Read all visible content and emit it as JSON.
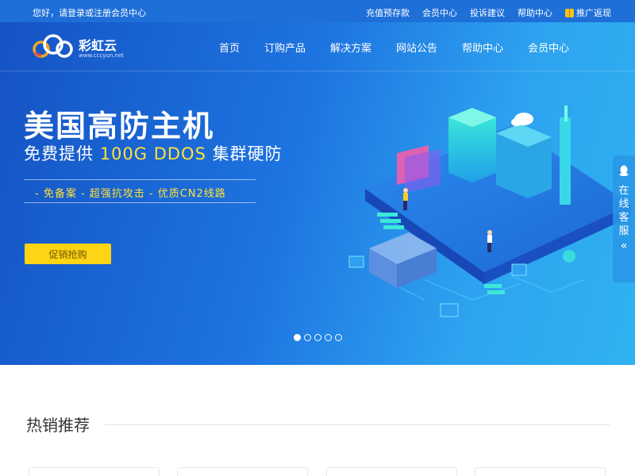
{
  "topbar": {
    "greeting": "您好，请登录或注册会员中心",
    "links": [
      "充值预存款",
      "会员中心",
      "投诉建议",
      "帮助中心"
    ],
    "promo_label": "推广返现"
  },
  "logo": {
    "name": "彩虹云",
    "url": "www.cccyun.net"
  },
  "nav": {
    "items": [
      "首页",
      "订购产品",
      "解决方案",
      "网站公告",
      "帮助中心",
      "会员中心"
    ]
  },
  "banner": {
    "title": "美国高防主机",
    "subtitle_pre": "免费提供 ",
    "subtitle_highlight": "100G DDOS",
    "subtitle_post": " 集群硬防",
    "features": "- 免备案  - 超强抗攻击  - 优质CN2线路",
    "cta_label": "促销抢购",
    "slide_count": 5,
    "active_slide": 1
  },
  "side_service": {
    "chars": [
      "在",
      "线",
      "客",
      "服"
    ],
    "chevron": "«"
  },
  "section": {
    "title": "热销推荐"
  },
  "colors": {
    "topbar": "#1e6fd8",
    "accent_yellow": "#ffd415",
    "highlight_yellow": "#ffe23a"
  }
}
